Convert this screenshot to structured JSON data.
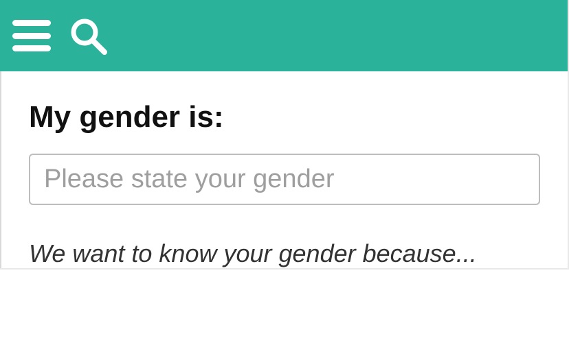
{
  "colors": {
    "header_bg": "#2ab29b"
  },
  "icons": {
    "menu": "hamburger-icon",
    "search": "search-icon"
  },
  "form": {
    "heading": "My gender is:",
    "gender_placeholder": "Please state your gender",
    "explanation": "We want to know your gender because..."
  }
}
